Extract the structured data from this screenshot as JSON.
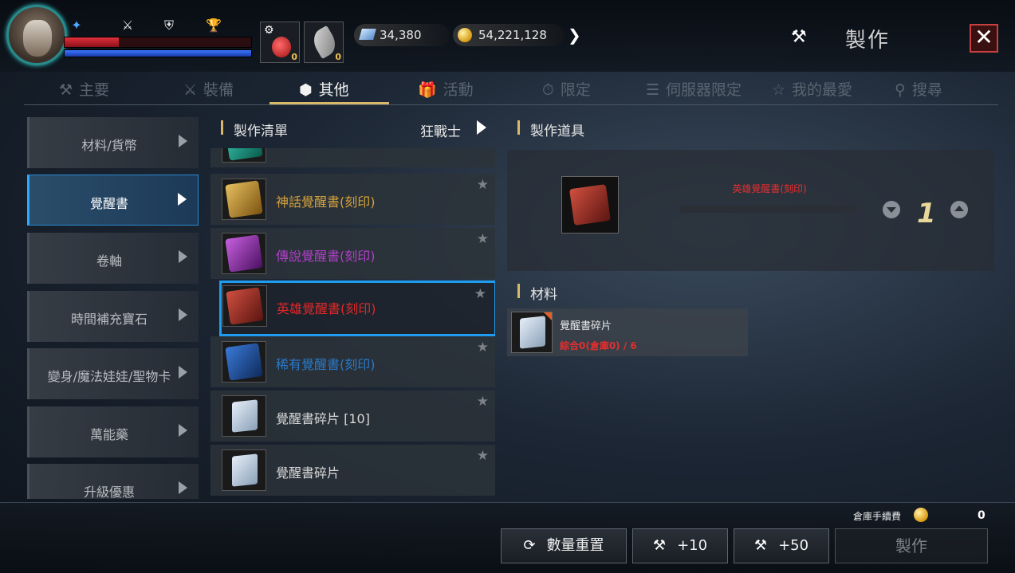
{
  "header": {
    "diamonds": "34,380",
    "gold": "54,221,128",
    "title": "製作",
    "close_label": "✕",
    "hp_percent": 0.29,
    "mp_percent": 1.0,
    "item_slots": [
      {
        "icon": "potion-icon",
        "count": "0"
      },
      {
        "icon": "feather-icon",
        "count": "0"
      }
    ],
    "stat_icons": [
      "buff-icon",
      "sword-icon",
      "helmet-icon",
      "trophy-icon"
    ]
  },
  "tabs": [
    {
      "icon": "anvil-icon",
      "label": "主要",
      "active": false
    },
    {
      "icon": "crossed-swords-icon",
      "label": "裝備",
      "active": false
    },
    {
      "icon": "box-icon",
      "label": "其他",
      "active": true
    },
    {
      "icon": "gift-icon",
      "label": "活動",
      "active": false
    },
    {
      "icon": "stopwatch-icon",
      "label": "限定",
      "active": false
    },
    {
      "icon": "server-icon",
      "label": "伺服器限定",
      "active": false
    },
    {
      "icon": "star-outline-icon",
      "label": "我的最愛",
      "active": false
    },
    {
      "icon": "search-icon",
      "label": "搜尋",
      "active": false
    }
  ],
  "categories": [
    {
      "label": "材料/貨幣",
      "active": false
    },
    {
      "label": "覺醒書",
      "active": true
    },
    {
      "label": "卷軸",
      "active": false
    },
    {
      "label": "時間補充寶石",
      "active": false
    },
    {
      "label": "變身/魔法娃娃/聖物卡",
      "active": false
    },
    {
      "label": "萬能藥",
      "active": false
    },
    {
      "label": "升級優惠",
      "active": false
    }
  ],
  "craft_list": {
    "title": "製作清單",
    "class_label": "狂戰士",
    "items": [
      {
        "name": "",
        "color": "#2ab09a"
      },
      {
        "name": "神話覺醒書(刻印)",
        "color": "#d4a23a"
      },
      {
        "name": "傳說覺醒書(刻印)",
        "color": "#b040c8"
      },
      {
        "name": "英雄覺醒書(刻印)",
        "color": "#e02828"
      },
      {
        "name": "稀有覺醒書(刻印)",
        "color": "#2a7ac8"
      },
      {
        "name": "覺醒書碎片 [10]",
        "color": "#d8d8d8"
      },
      {
        "name": "覺醒書碎片",
        "color": "#d8d8d8"
      }
    ]
  },
  "detail": {
    "title": "製作道具",
    "item_name": "英雄覺醒書(刻印)",
    "quantity": "1",
    "progress": 0.0
  },
  "materials": {
    "title": "材料",
    "items": [
      {
        "name": "覺醒書碎片",
        "count": "綜合0(倉庫0) / 6"
      }
    ]
  },
  "footer": {
    "fee_label": "倉庫手續費",
    "fee_value": "0",
    "reset_label": "數量重置",
    "plus10_label": "+10",
    "plus50_label": "+50",
    "craft_label": "製作"
  }
}
